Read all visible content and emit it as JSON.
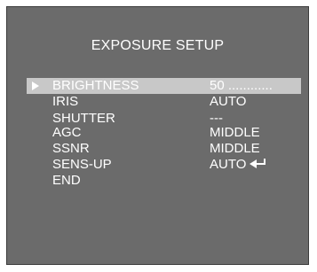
{
  "menu": {
    "title": "EXPOSURE SETUP",
    "items": [
      {
        "label": "BRIGHTNESS",
        "value": "50 ............",
        "selected": true
      },
      {
        "label": "IRIS",
        "value": "AUTO"
      },
      {
        "label": "SHUTTER",
        "value": "---"
      },
      {
        "label": "AGC",
        "value": "MIDDLE"
      },
      {
        "label": "SSNR",
        "value": "MIDDLE"
      },
      {
        "label": "SENS-UP",
        "value": "AUTO",
        "icon": "enter-arrow-icon"
      },
      {
        "label": "END",
        "value": ""
      }
    ]
  },
  "colors": {
    "background": "#6b6b6b",
    "highlight": "#c8c8c8",
    "text": "#ffffff"
  }
}
